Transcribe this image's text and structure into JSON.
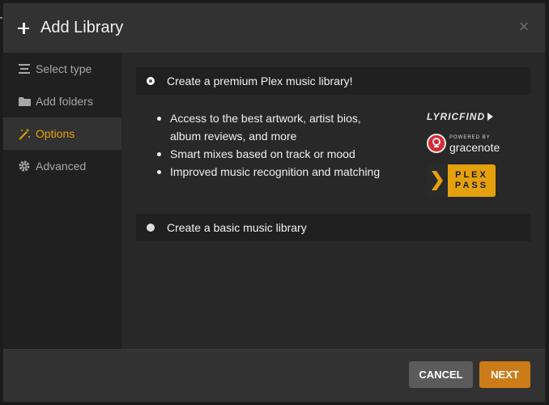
{
  "dialog": {
    "title": "Add Library",
    "icons": {
      "header": "plus-icon",
      "close": "close-icon"
    }
  },
  "sidebar": {
    "items": [
      {
        "label": "Select type",
        "icon": "list-icon",
        "active": false
      },
      {
        "label": "Add folders",
        "icon": "folder-icon",
        "active": false
      },
      {
        "label": "Options",
        "icon": "magic-wand-icon",
        "active": true
      },
      {
        "label": "Advanced",
        "icon": "gear-icon",
        "active": false
      }
    ]
  },
  "main": {
    "premium_option": {
      "label": "Create a premium Plex music library!",
      "checked": true
    },
    "features": [
      "Access to the best artwork, artist bios,",
      "album reviews, and more",
      "Smart mixes based on track or mood",
      "Improved music recognition and matching"
    ],
    "logos": {
      "lyricfind": "LyricFind",
      "gracenote_small": "POWERED BY",
      "gracenote": "gracenote",
      "plex_line1": "PLEX",
      "plex_line2": "PASS"
    },
    "basic_option": {
      "label": "Create a basic music library",
      "checked": false
    }
  },
  "footer": {
    "cancel_label": "CANCEL",
    "next_label": "NEXT"
  },
  "colors": {
    "accent": "#e5a00d",
    "next_button": "#cc7b19",
    "cancel_button": "#5b5b5b",
    "gracenote_red": "#d52b36"
  }
}
